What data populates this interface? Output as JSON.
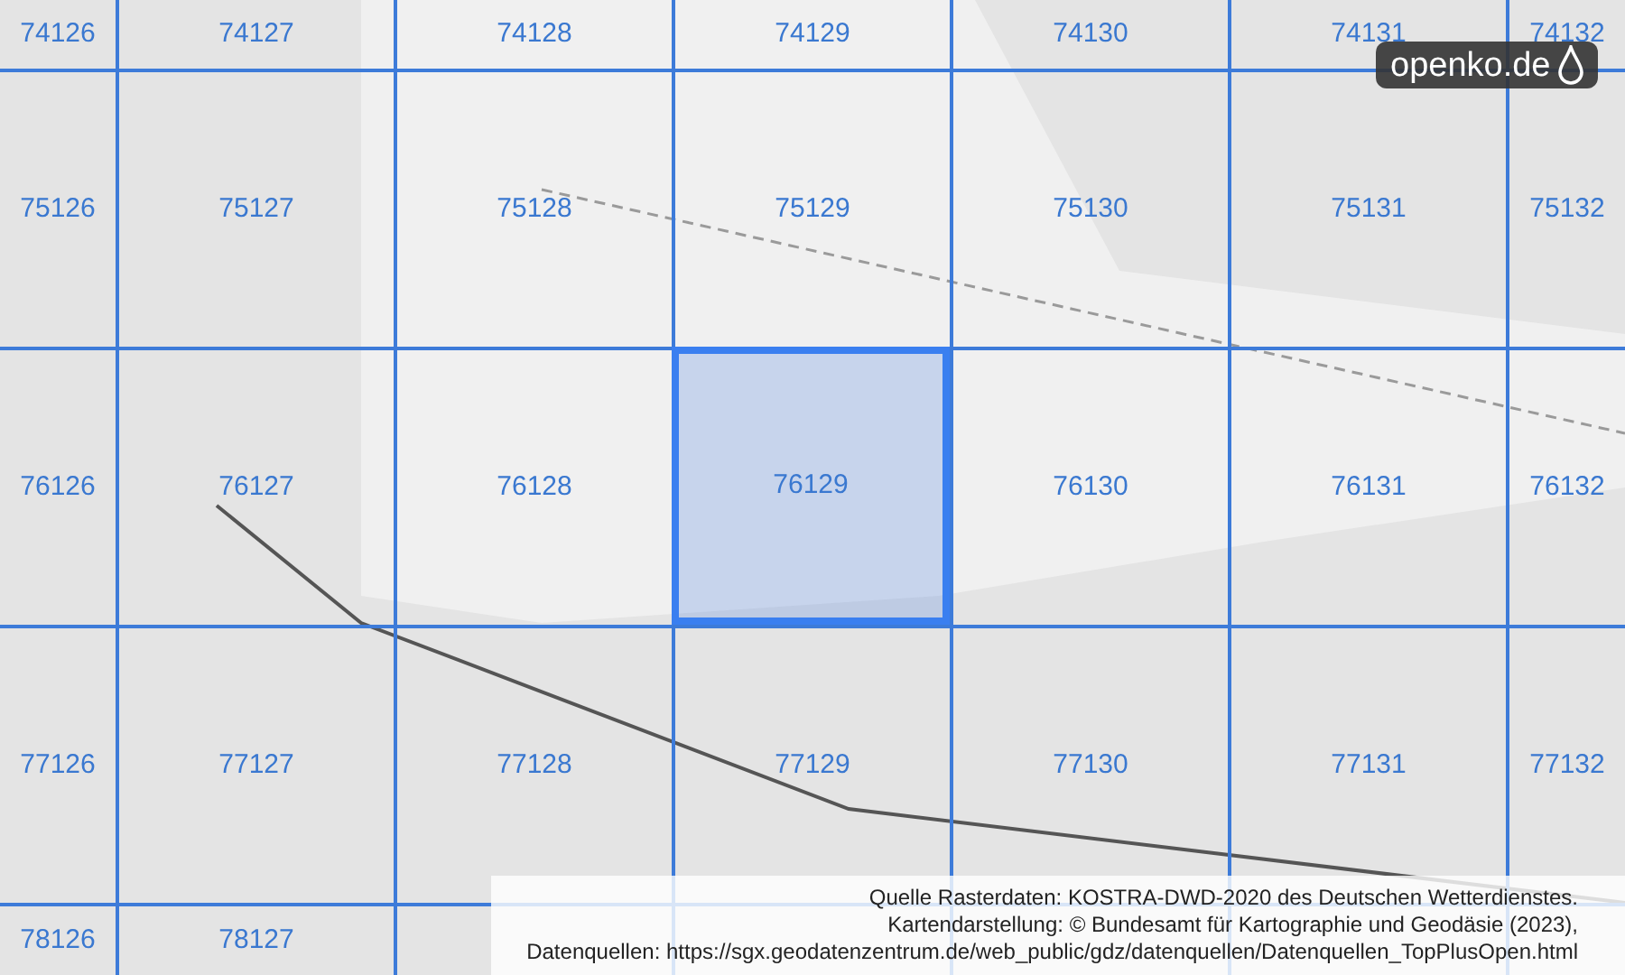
{
  "grid": {
    "rows": [
      {
        "cells": [
          {
            "label": "74126",
            "selected": false
          },
          {
            "label": "74127",
            "selected": false
          },
          {
            "label": "74128",
            "selected": false
          },
          {
            "label": "74129",
            "selected": false
          },
          {
            "label": "74130",
            "selected": false
          },
          {
            "label": "74131",
            "selected": false
          },
          {
            "label": "74132",
            "selected": false
          }
        ]
      },
      {
        "cells": [
          {
            "label": "75126",
            "selected": false
          },
          {
            "label": "75127",
            "selected": false
          },
          {
            "label": "75128",
            "selected": false
          },
          {
            "label": "75129",
            "selected": false
          },
          {
            "label": "75130",
            "selected": false
          },
          {
            "label": "75131",
            "selected": false
          },
          {
            "label": "75132",
            "selected": false
          }
        ]
      },
      {
        "cells": [
          {
            "label": "76126",
            "selected": false
          },
          {
            "label": "76127",
            "selected": false
          },
          {
            "label": "76128",
            "selected": false
          },
          {
            "label": "76129",
            "selected": true
          },
          {
            "label": "76130",
            "selected": false
          },
          {
            "label": "76131",
            "selected": false
          },
          {
            "label": "76132",
            "selected": false
          }
        ]
      },
      {
        "cells": [
          {
            "label": "77126",
            "selected": false
          },
          {
            "label": "77127",
            "selected": false
          },
          {
            "label": "77128",
            "selected": false
          },
          {
            "label": "77129",
            "selected": false
          },
          {
            "label": "77130",
            "selected": false
          },
          {
            "label": "77131",
            "selected": false
          },
          {
            "label": "77132",
            "selected": false
          }
        ]
      },
      {
        "cells": [
          {
            "label": "78126",
            "selected": false
          },
          {
            "label": "78127",
            "selected": false
          }
        ]
      }
    ]
  },
  "logo": {
    "text": "openko.de"
  },
  "attribution": [
    "Quelle Rasterdaten: KOSTRA-DWD-2020 des Deutschen Wetterdienstes.",
    "Kartendarstellung: © Bundesamt für Kartographie und Geodäsie (2023),",
    "Datenquellen: https://sgx.geodatenzentrum.de/web_public/gdz/datenquellen/Datenquellen_TopPlusOpen.html"
  ]
}
